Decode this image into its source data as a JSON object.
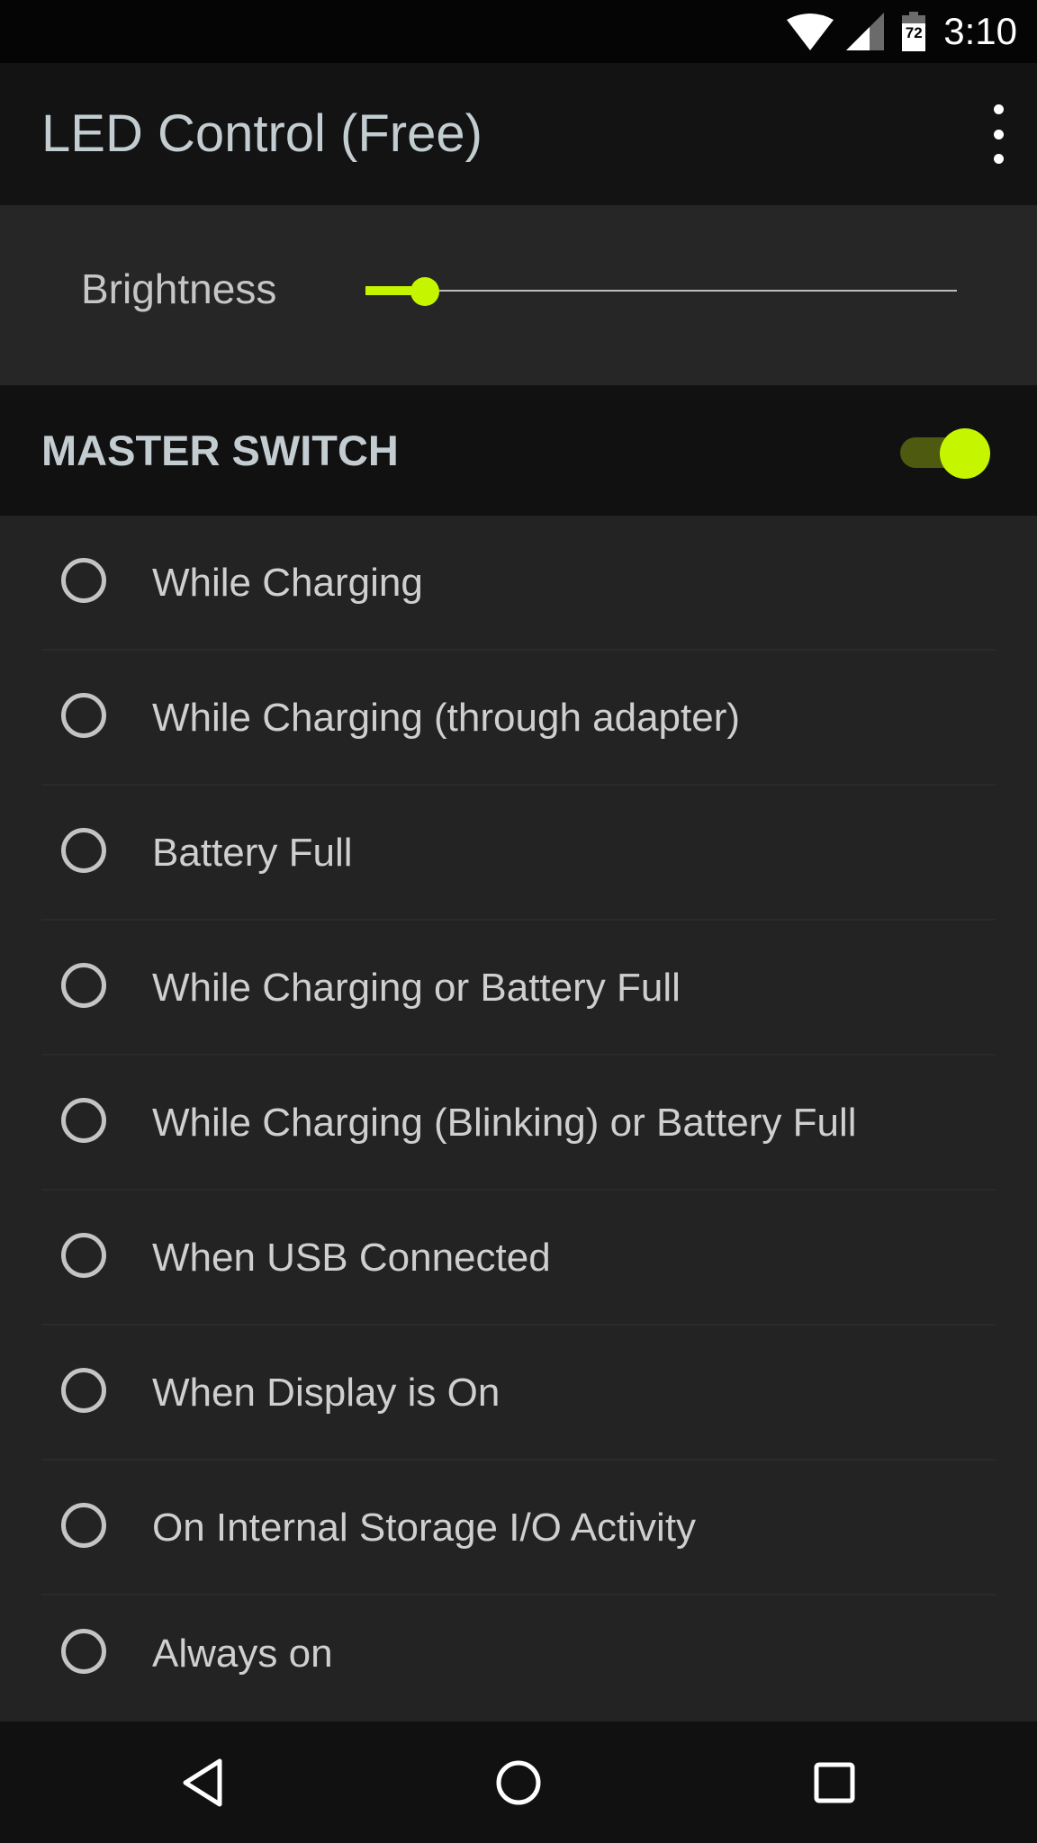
{
  "status_bar": {
    "time": "3:10",
    "battery_level": "72",
    "icons": [
      "wifi-icon",
      "cell-signal-icon",
      "battery-icon"
    ]
  },
  "app_bar": {
    "title": "LED Control (Free)",
    "overflow_icon": "more-vert-icon"
  },
  "brightness": {
    "label": "Brightness",
    "value_percent": 10,
    "accent_color": "#c6f500"
  },
  "master_switch": {
    "label": "MASTER SWITCH",
    "on": true
  },
  "options": [
    {
      "label": "While Charging",
      "selected": false
    },
    {
      "label": "While Charging (through adapter)",
      "selected": false
    },
    {
      "label": "Battery Full",
      "selected": false
    },
    {
      "label": "While Charging or Battery Full",
      "selected": false
    },
    {
      "label": "While Charging (Blinking) or Battery Full",
      "selected": false
    },
    {
      "label": "When USB Connected",
      "selected": false
    },
    {
      "label": "When Display is On",
      "selected": false
    },
    {
      "label": "On Internal Storage I/O Activity",
      "selected": false
    },
    {
      "label": "Always on",
      "selected": false
    }
  ],
  "nav_bar": {
    "buttons": [
      "back-icon",
      "home-icon",
      "recents-icon"
    ]
  }
}
